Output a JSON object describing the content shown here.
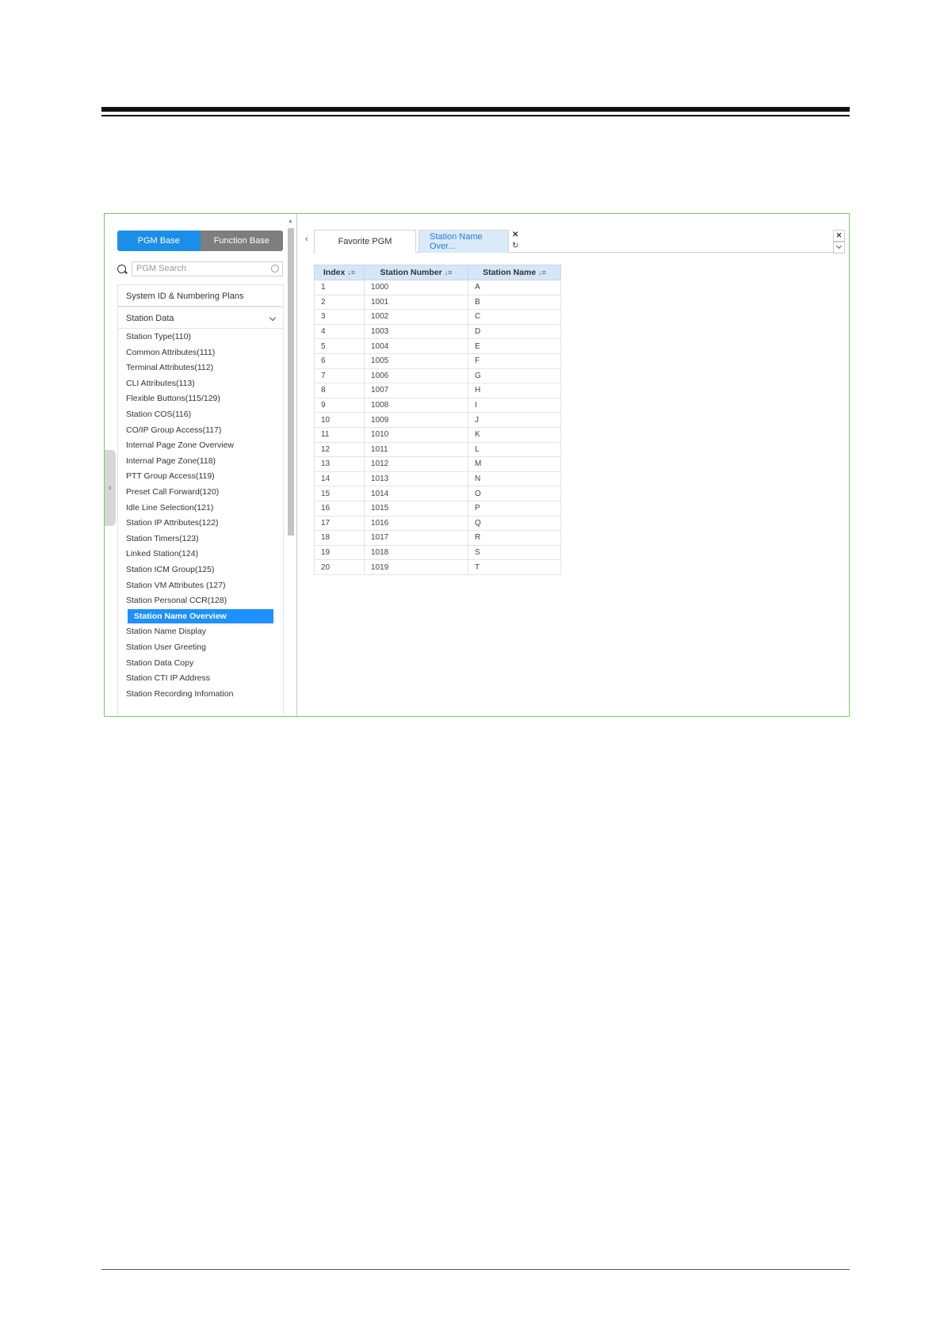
{
  "pgm": {
    "mode_tabs": [
      "PGM Base",
      "Function Base"
    ],
    "search_placeholder": "PGM Search",
    "menu_system": "System ID & Numbering Plans",
    "menu_station_data": "Station Data",
    "sub_items": [
      "Station Type(110)",
      "Common Attributes(111)",
      "Terminal Attributes(112)",
      "CLI Attributes(113)",
      "Flexible Buttons(115/129)",
      "Station COS(116)",
      "CO/IP Group Access(117)",
      "Internal Page Zone Overview",
      "Internal Page Zone(118)",
      "PTT Group Access(119)",
      "Preset Call Forward(120)",
      "Idle Line Selection(121)",
      "Station IP Attributes(122)",
      "Station Timers(123)",
      "Linked Station(124)",
      "Station ICM Group(125)",
      "Station VM Attributes (127)",
      "Station Personal CCR(128)",
      "Station Name Overview",
      "Station Name Display",
      "Station User Greeting",
      "Station Data Copy",
      "Station CTI IP Address",
      "Station Recording Infomation"
    ],
    "selected_index": 18
  },
  "tabs": {
    "favorite": "Favorite PGM",
    "active": "Station Name Over..."
  },
  "table": {
    "headers": [
      "Index",
      "Station Number",
      "Station Name"
    ],
    "sort_glyph": "↓≡",
    "rows": [
      [
        "1",
        "1000",
        "A"
      ],
      [
        "2",
        "1001",
        "B"
      ],
      [
        "3",
        "1002",
        "C"
      ],
      [
        "4",
        "1003",
        "D"
      ],
      [
        "5",
        "1004",
        "E"
      ],
      [
        "6",
        "1005",
        "F"
      ],
      [
        "7",
        "1006",
        "G"
      ],
      [
        "8",
        "1007",
        "H"
      ],
      [
        "9",
        "1008",
        "I"
      ],
      [
        "10",
        "1009",
        "J"
      ],
      [
        "11",
        "1010",
        "K"
      ],
      [
        "12",
        "1011",
        "L"
      ],
      [
        "13",
        "1012",
        "M"
      ],
      [
        "14",
        "1013",
        "N"
      ],
      [
        "15",
        "1014",
        "O"
      ],
      [
        "16",
        "1015",
        "P"
      ],
      [
        "17",
        "1016",
        "Q"
      ],
      [
        "18",
        "1017",
        "R"
      ],
      [
        "19",
        "1018",
        "S"
      ],
      [
        "20",
        "1019",
        "T"
      ]
    ]
  },
  "colors": {
    "accent": "#1e90ff",
    "frame": "#7dc86a",
    "header_bg": "#d4e6f7"
  }
}
